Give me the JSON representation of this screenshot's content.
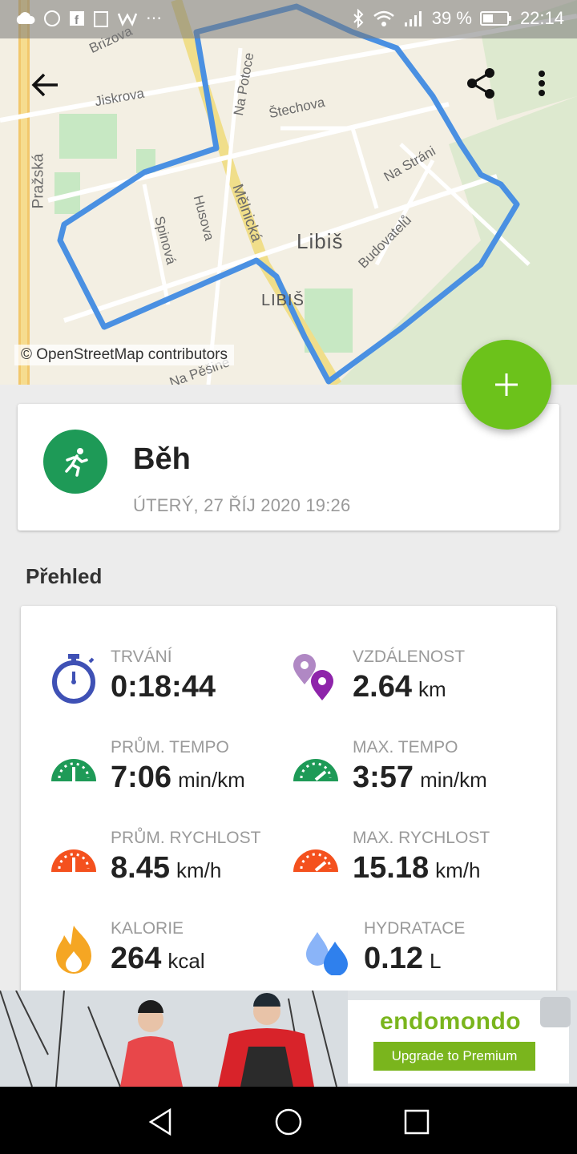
{
  "status_bar": {
    "battery": "39 %",
    "time": "22:14"
  },
  "map": {
    "attribution": "© OpenStreetMap contributors",
    "streets": [
      "Brizova",
      "Jiskrova",
      "Na Potoce",
      "Štechova",
      "Na Stráni",
      "Mělnická",
      "Husova",
      "Spinová",
      "Pražská",
      "Budovatelů",
      "LIBIŠ",
      "Libiš",
      "Na Pěšině"
    ]
  },
  "toolbar": {
    "back_icon": "arrow-left-icon",
    "share_icon": "share-icon",
    "menu_icon": "more-vert-icon"
  },
  "fab": {
    "icon": "plus-icon",
    "color": "#6cc21b"
  },
  "activity": {
    "sport": "Běh",
    "date": "ÚTERÝ, 27 ŘÍJ 2020 19:26",
    "icon": "running-icon",
    "color": "#1e9a57"
  },
  "overview": {
    "title": "Přehled",
    "stats": [
      {
        "label": "TRVÁNÍ",
        "value": "0:18:44",
        "unit": "",
        "icon": "stopwatch-icon"
      },
      {
        "label": "VZDÁLENOST",
        "value": "2.64",
        "unit": "km",
        "icon": "map-pins-icon"
      },
      {
        "label": "PRŮM. TEMPO",
        "value": "7:06",
        "unit": "min/km",
        "icon": "avg-pace-gauge-icon"
      },
      {
        "label": "MAX. TEMPO",
        "value": "3:57",
        "unit": "min/km",
        "icon": "max-pace-gauge-icon"
      },
      {
        "label": "PRŮM. RYCHLOST",
        "value": "8.45",
        "unit": "km/h",
        "icon": "avg-speed-gauge-icon"
      },
      {
        "label": "MAX. RYCHLOST",
        "value": "15.18",
        "unit": "km/h",
        "icon": "max-speed-gauge-icon"
      },
      {
        "label": "KALORIE",
        "value": "264",
        "unit": "kcal",
        "icon": "flame-icon"
      },
      {
        "label": "HYDRATACE",
        "value": "0.12",
        "unit": "L",
        "icon": "water-drops-icon"
      }
    ]
  },
  "ad": {
    "brand": "endomondo",
    "cta": "Upgrade to Premium"
  }
}
